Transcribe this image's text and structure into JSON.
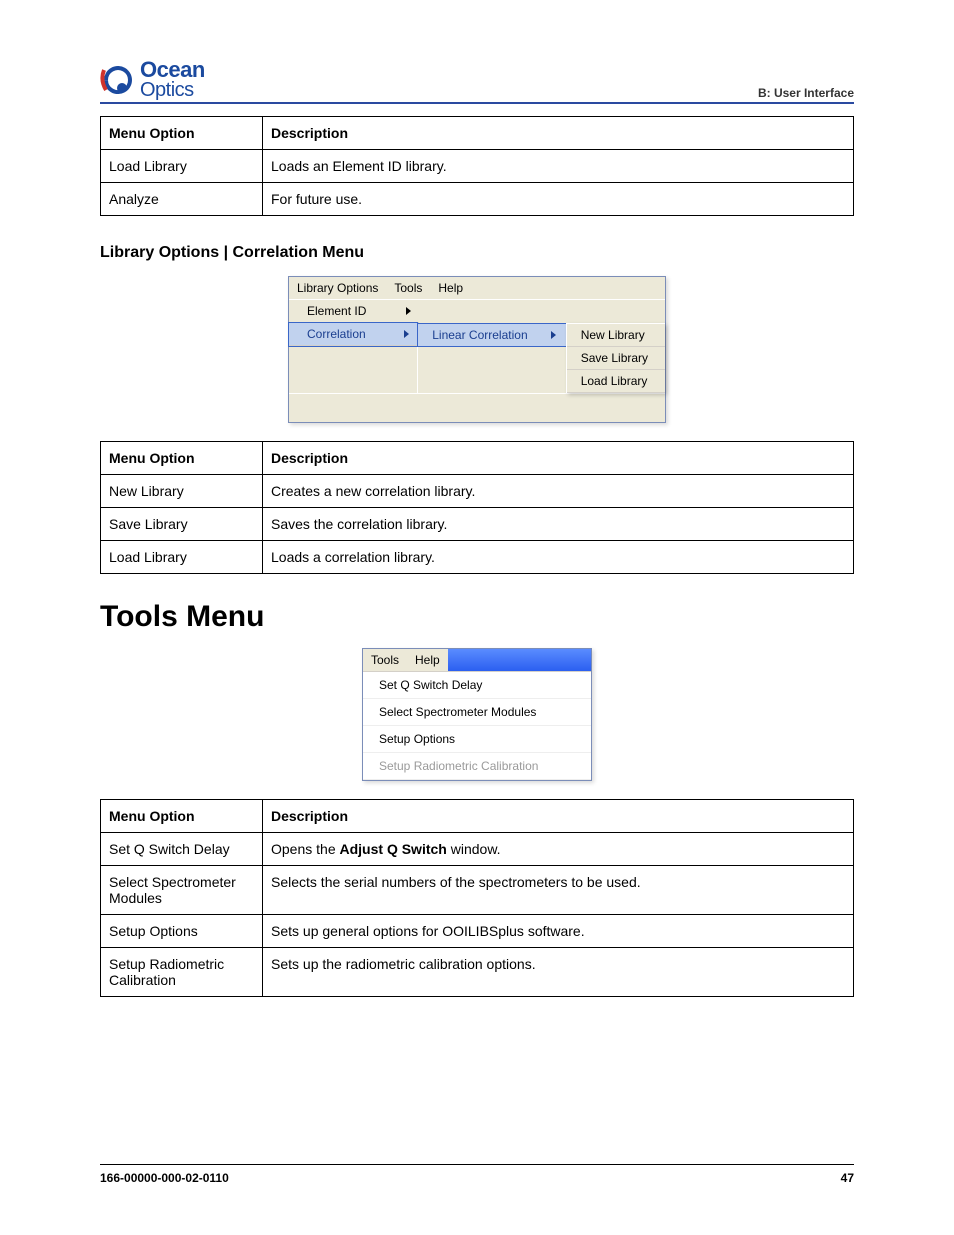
{
  "header": {
    "section_label": "B: User Interface",
    "logo_top": "Ocean",
    "logo_bottom": "Optics"
  },
  "tables": {
    "col_menu": "Menu Option",
    "col_desc": "Description"
  },
  "table1": {
    "rows": [
      {
        "menu": "Load Library",
        "desc": "Loads an Element ID library."
      },
      {
        "menu": "Analyze",
        "desc": "For future use."
      }
    ]
  },
  "section1_title": "Library Options | Correlation Menu",
  "fig1": {
    "menubar": {
      "lib": "Library Options",
      "tools": "Tools",
      "help": "Help"
    },
    "sub": {
      "element": "Element  ID",
      "correlation": "Correlation"
    },
    "sub2": {
      "linear": "Linear Correlation"
    },
    "sub3": {
      "new": "New Library",
      "save": "Save Library",
      "load": "Load Library"
    }
  },
  "table2": {
    "rows": [
      {
        "menu": "New Library",
        "desc": "Creates a new correlation library."
      },
      {
        "menu": "Save Library",
        "desc": "Saves the correlation library."
      },
      {
        "menu": "Load Library",
        "desc": "Loads a correlation library."
      }
    ]
  },
  "section2_title": "Tools Menu",
  "fig2": {
    "menubar": {
      "tools": "Tools",
      "help": "Help"
    },
    "items": {
      "q": "Set Q Switch Delay",
      "spec": "Select Spectrometer Modules",
      "setup": "Setup Options",
      "radio": "Setup Radiometric Calibration"
    }
  },
  "table3": {
    "rows": [
      {
        "menu": "Set Q Switch Delay",
        "desc_pre": "Opens the ",
        "desc_bold": "Adjust Q Switch",
        "desc_post": " window."
      },
      {
        "menu": "Select Spectrometer Modules",
        "desc": "Selects the serial numbers of the spectrometers to be used."
      },
      {
        "menu": "Setup Options",
        "desc": "Sets up general options for OOILIBSplus software."
      },
      {
        "menu": "Setup Radiometric Calibration",
        "desc": "Sets up the radiometric calibration options."
      }
    ]
  },
  "footer": {
    "docnum": "166-00000-000-02-0110",
    "page": "47"
  }
}
